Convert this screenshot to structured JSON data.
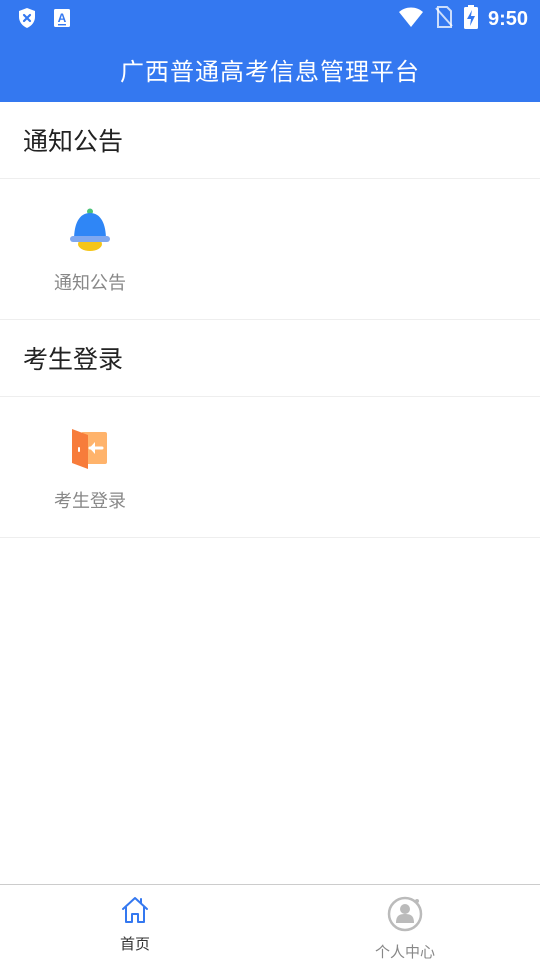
{
  "status_bar": {
    "time": "9:50",
    "icons": [
      "shield-x-icon",
      "text-a-icon",
      "wifi-icon",
      "no-sim-icon",
      "battery-charging-icon"
    ]
  },
  "app_bar": {
    "title": "广西普通高考信息管理平台"
  },
  "sections": [
    {
      "header": "通知公告",
      "tile": {
        "label": "通知公告",
        "icon": "bell-icon"
      }
    },
    {
      "header": "考生登录",
      "tile": {
        "label": "考生登录",
        "icon": "door-login-icon"
      }
    }
  ],
  "tab_bar": {
    "tabs": [
      {
        "label": "首页",
        "icon": "home-icon",
        "active": true
      },
      {
        "label": "个人中心",
        "icon": "profile-icon",
        "active": false
      }
    ]
  },
  "colors": {
    "primary": "#3478f0",
    "bell_blue": "#2f86f6",
    "bell_yellow": "#f5c518",
    "door_orange": "#f77c3b"
  }
}
